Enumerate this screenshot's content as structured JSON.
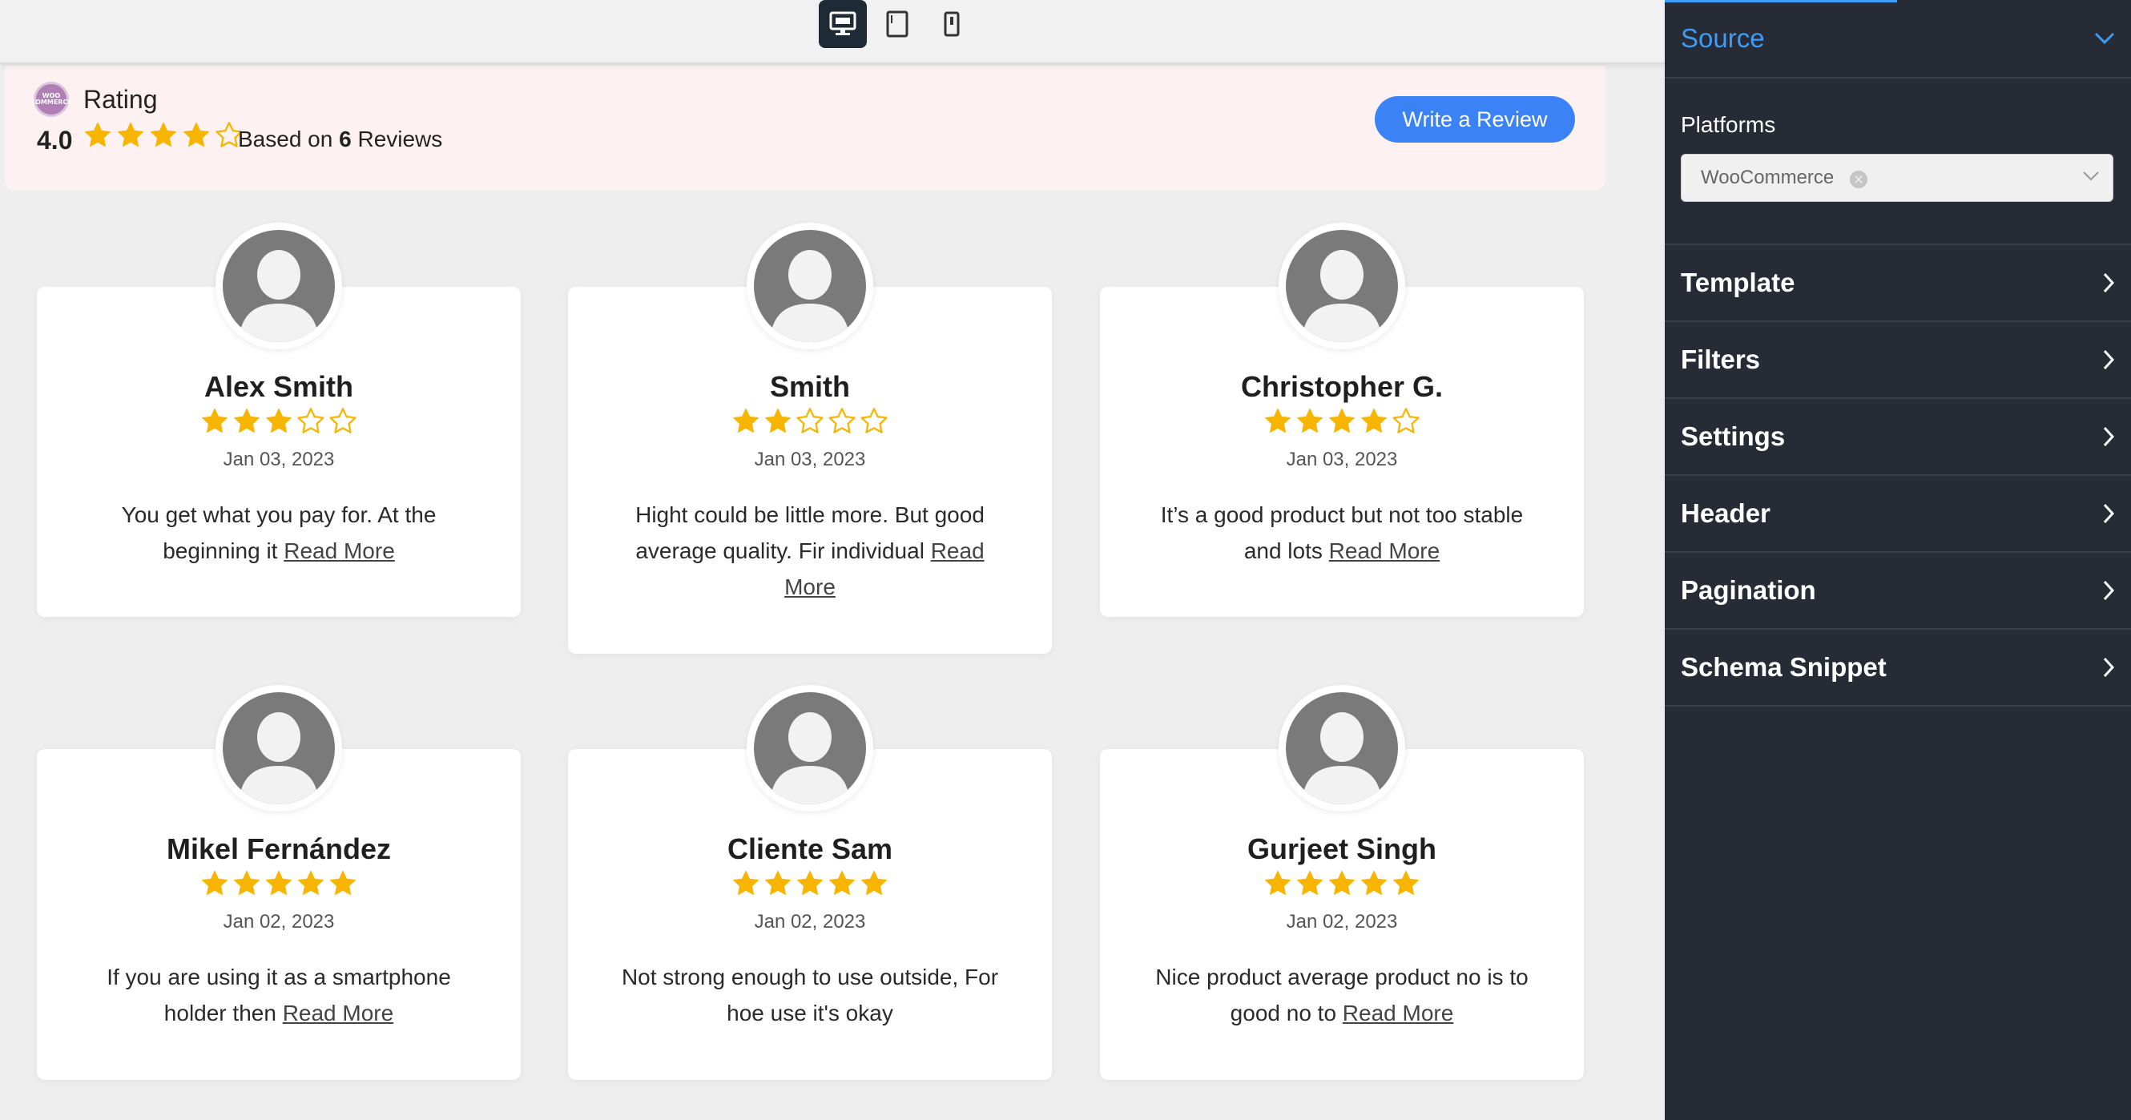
{
  "toolbar": {
    "devices": [
      {
        "name": "desktop",
        "active": true
      },
      {
        "name": "tablet",
        "active": false
      },
      {
        "name": "mobile",
        "active": false
      }
    ]
  },
  "header": {
    "platform_logo_text": "WOO COMMERCE",
    "title": "Rating",
    "average": "4.0",
    "average_stars": 4,
    "based_prefix": "Based on",
    "review_count": "6",
    "based_suffix": "Reviews",
    "write_review_label": "Write a Review"
  },
  "reviews": [
    {
      "name": "Alex Smith",
      "stars": 3,
      "date": "Jan 03, 2023",
      "text": "You get what you pay for. At the beginning it",
      "read_more": "Read More"
    },
    {
      "name": "Smith",
      "stars": 2,
      "date": "Jan 03, 2023",
      "text": "Hight could be little more. But good average quality. Fir individual",
      "read_more": "Read More"
    },
    {
      "name": "Christopher G.",
      "stars": 4,
      "date": "Jan 03, 2023",
      "text": "It’s a good product but not too stable and lots",
      "read_more": "Read More"
    },
    {
      "name": "Mikel Fernández",
      "stars": 5,
      "date": "Jan 02, 2023",
      "text": "If you are using it as a smartphone holder then",
      "read_more": "Read More"
    },
    {
      "name": "Cliente Sam",
      "stars": 5,
      "date": "Jan 02, 2023",
      "text": "Not strong enough to use outside, For hoe use it's okay",
      "read_more": ""
    },
    {
      "name": "Gurjeet Singh",
      "stars": 5,
      "date": "Jan 02, 2023",
      "text": "Nice product average product no is to good no to",
      "read_more": "Read More"
    }
  ],
  "panel": {
    "source_label": "Source",
    "platforms_label": "Platforms",
    "platform_selected": "WooCommerce",
    "sections": [
      "Template",
      "Filters",
      "Settings",
      "Header",
      "Pagination",
      "Schema Snippet"
    ]
  },
  "colors": {
    "star": "#f7b500",
    "star_empty_stroke": "#f7b500",
    "accent": "#3b82f6",
    "panel_bg": "#272b35",
    "panel_active": "#3d9df6",
    "header_bg": "#fdf2f1"
  }
}
